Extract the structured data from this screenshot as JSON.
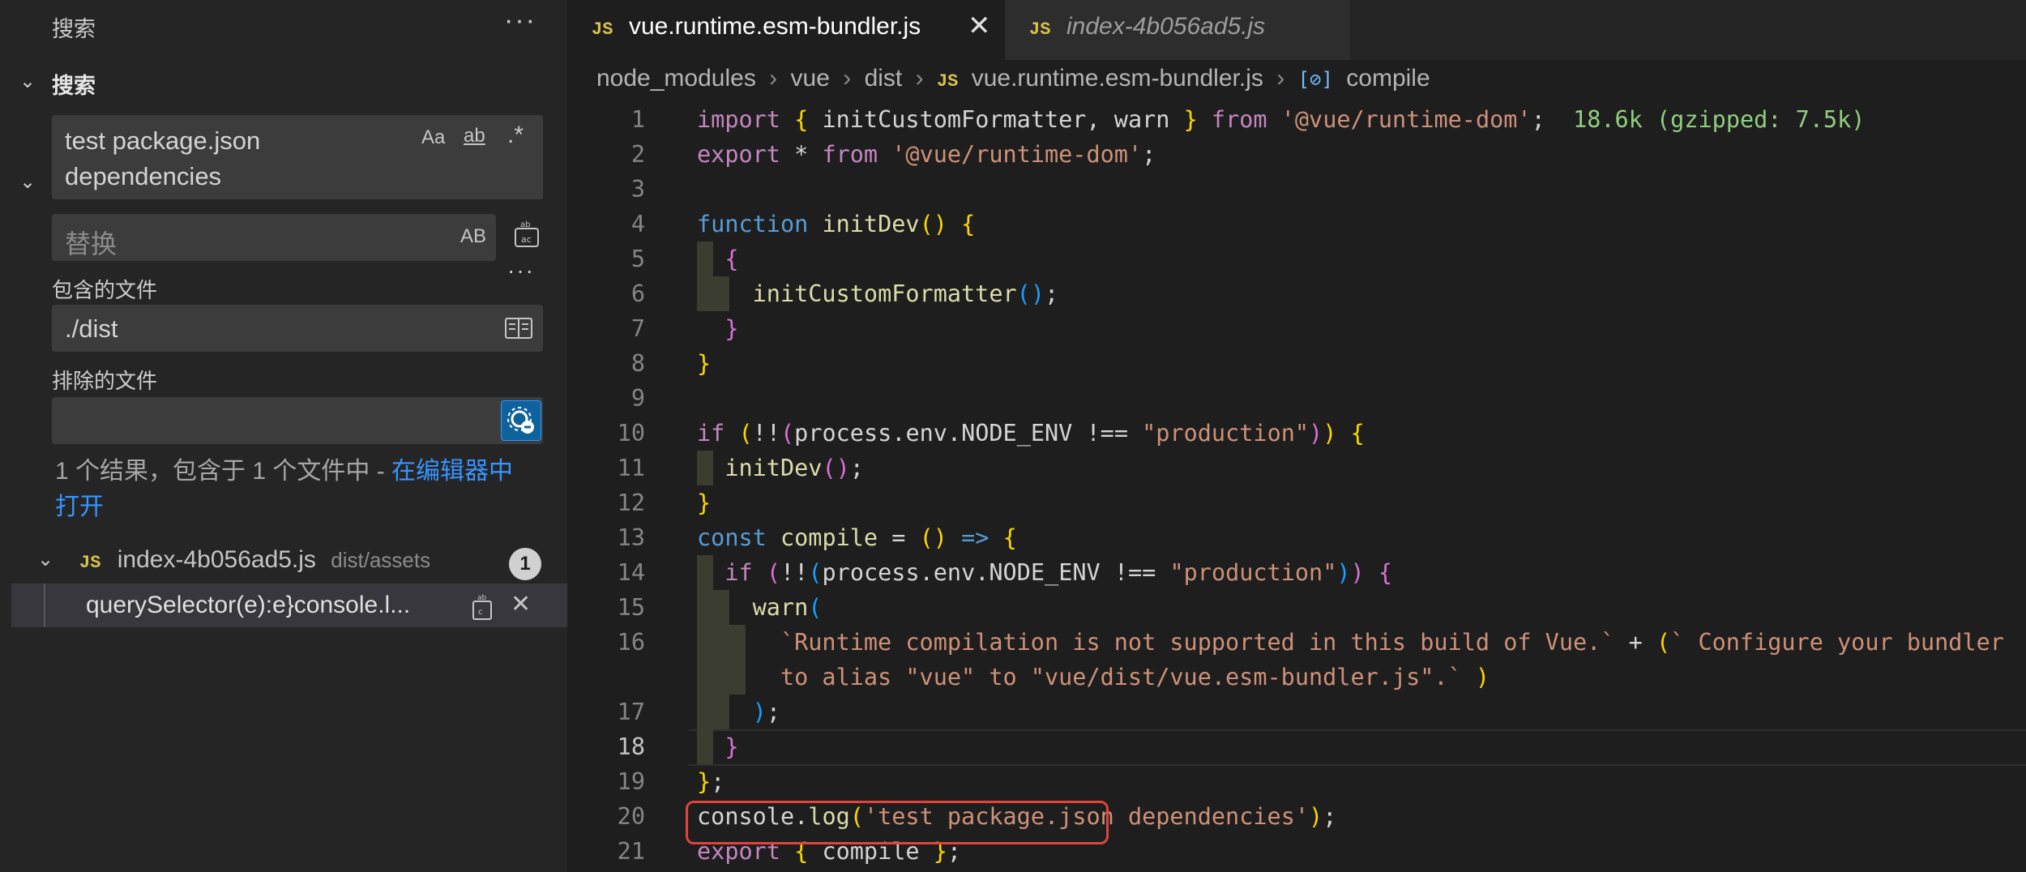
{
  "sidebar": {
    "title": "搜索",
    "section": "搜索",
    "search": {
      "query_line1": "test package.json",
      "query_line2": "dependencies",
      "opt_case": "Aa",
      "opt_word": "ab",
      "opt_regex": ".*"
    },
    "replace": {
      "placeholder": "替换",
      "opt_preserve": "AB"
    },
    "include": {
      "label": "包含的文件",
      "value": "./dist"
    },
    "exclude": {
      "label": "排除的文件",
      "value": ""
    },
    "summary": {
      "text": "1 个结果，包含于 1 个文件中 - ",
      "link": "在编辑器中打开"
    },
    "result_file": {
      "badge": "JS",
      "name": "index-4b056ad5.js",
      "path": "dist/assets",
      "count": "1"
    },
    "match": {
      "text": "querySelector(e):e}console.l..."
    }
  },
  "tabs": [
    {
      "badge": "JS",
      "label": "vue.runtime.esm-bundler.js",
      "active": true
    },
    {
      "badge": "JS",
      "label": "index-4b056ad5.js",
      "active": false
    }
  ],
  "breadcrumb": {
    "items": [
      "node_modules",
      "vue",
      "dist",
      "vue.runtime.esm-bundler.js",
      "compile"
    ],
    "file_badge": "JS"
  },
  "editor": {
    "import_size_hint": "18.6k (gzipped: 7.5k)",
    "current_line": "18",
    "line_numbers": [
      "1",
      "2",
      "3",
      "4",
      "5",
      "6",
      "7",
      "8",
      "9",
      "10",
      "11",
      "12",
      "13",
      "14",
      "15",
      "16",
      "",
      "17",
      "18",
      "19",
      "20",
      "21"
    ]
  },
  "colors": {
    "keyword": "#569cd6",
    "control": "#c586c0",
    "function": "#dcdcaa",
    "string": "#ce9178",
    "highlight_box": "#e0443a",
    "link": "#3794ff"
  }
}
